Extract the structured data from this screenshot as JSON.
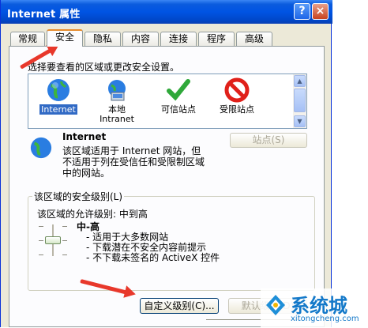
{
  "window": {
    "title": "Internet 属性",
    "help_glyph": "?",
    "close_glyph": "×"
  },
  "tabs": [
    {
      "label": "常规",
      "active": false
    },
    {
      "label": "安全",
      "active": true
    },
    {
      "label": "隐私",
      "active": false
    },
    {
      "label": "内容",
      "active": false
    },
    {
      "label": "连接",
      "active": false
    },
    {
      "label": "程序",
      "active": false
    },
    {
      "label": "高级",
      "active": false
    }
  ],
  "instruction": "选择要查看的区域或更改安全设置。",
  "zones": [
    {
      "label": "Internet",
      "icon": "globe-icon",
      "selected": true
    },
    {
      "label": "本地\nIntranet",
      "icon": "intranet-icon",
      "selected": false
    },
    {
      "label": "可信站点",
      "icon": "checkmark-icon",
      "selected": false
    },
    {
      "label": "受限站点",
      "icon": "no-entry-icon",
      "selected": false
    }
  ],
  "zone_info": {
    "title": "Internet",
    "description": "该区域适用于 Internet 网站，但\n不适用于列在受信任和受限制区域\n中的网站。",
    "sites_button": "站点(S)"
  },
  "security_level": {
    "group_label": "该区域的安全级别(L)",
    "allowed_level": "该区域的允许级别: 中到高",
    "level_name": "中-高",
    "bullets": [
      "- 适用于大多数网站",
      "- 下载潜在不安全内容前提示",
      "- 不下载未签名的 ActiveX 控件"
    ],
    "custom_button": "自定义级别(C)...",
    "default_button": "默认级别(D)"
  },
  "watermark": {
    "brand": "系统城",
    "url": "xitongcheng.com"
  },
  "colors": {
    "title_bar": "#0054e3",
    "tab_accent": "#e68b2c",
    "selection": "#316ac5",
    "arrow": "#e8382b"
  }
}
